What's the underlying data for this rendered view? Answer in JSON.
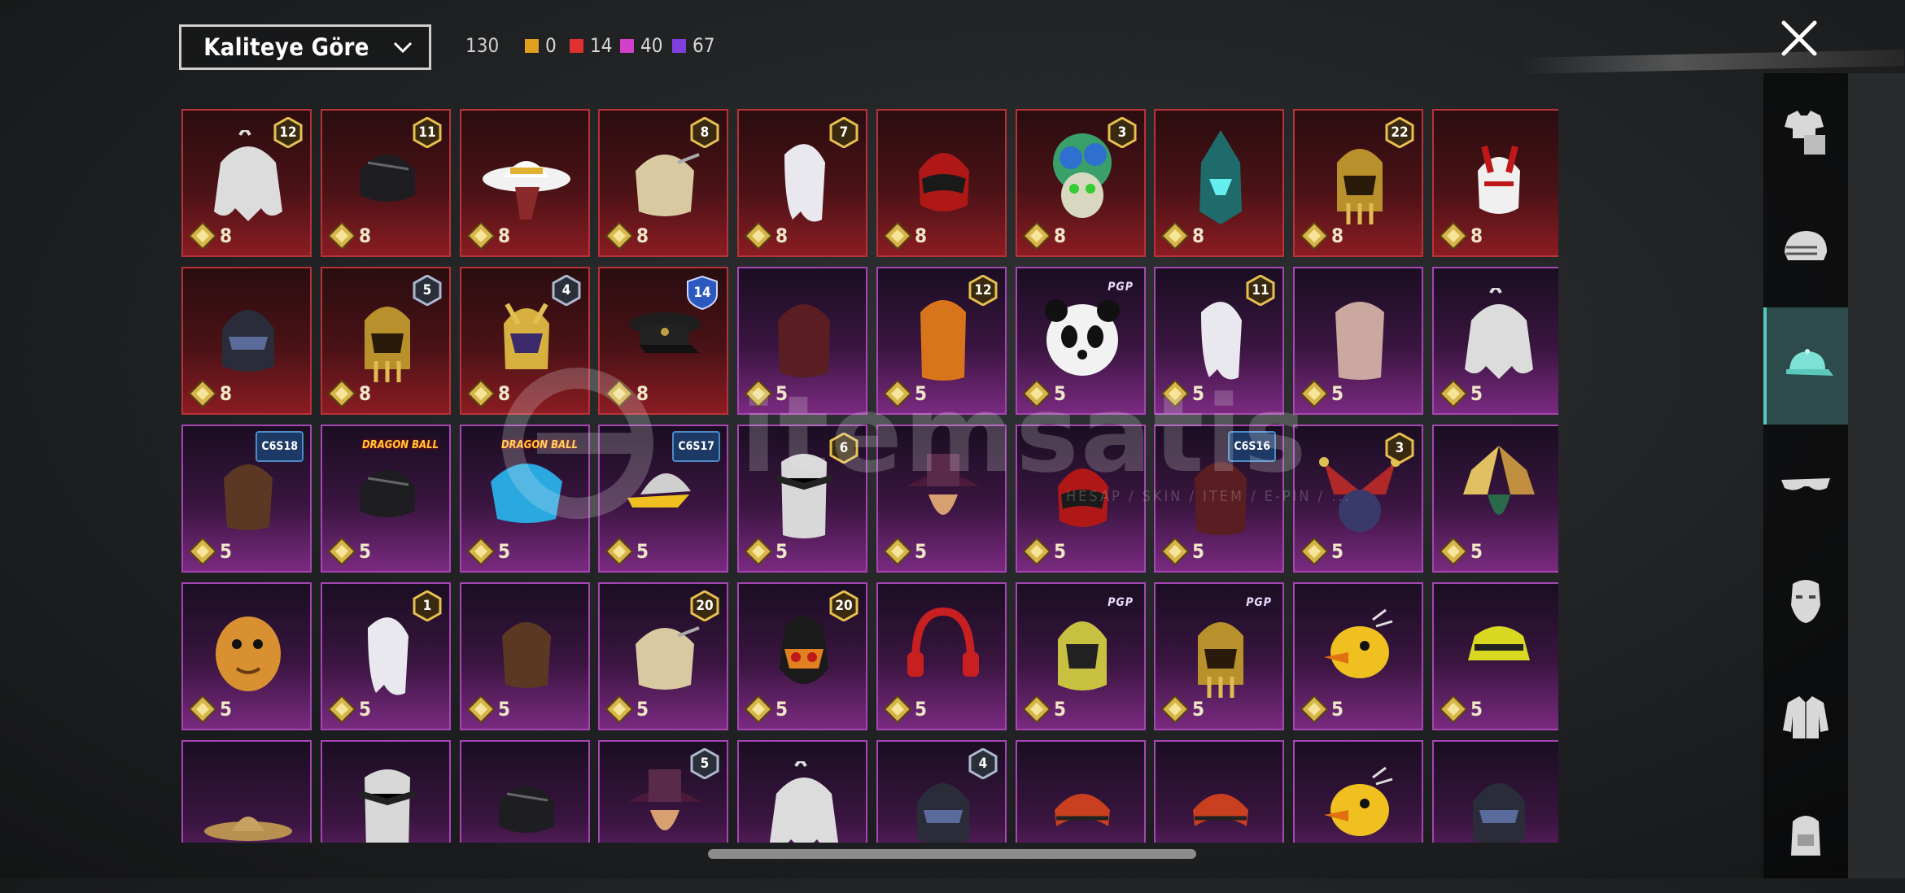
{
  "sort": {
    "label": "Kaliteye Göre"
  },
  "total_count": "130",
  "quality_counts": [
    {
      "value": "0",
      "color": "#e0a020"
    },
    {
      "value": "14",
      "color": "#e03030"
    },
    {
      "value": "40",
      "color": "#d040c8"
    },
    {
      "value": "67",
      "color": "#8040e0"
    }
  ],
  "watermark": {
    "text": "itemsatis",
    "subtitle": "HESAP / SKIN / ITEM / E-PIN / ..."
  },
  "sidebar_tabs": [
    "outfit-icon",
    "helmet-icon",
    "cap-icon",
    "glasses-icon",
    "mask-icon",
    "jacket-icon",
    "backpack-icon"
  ],
  "active_tab": 2,
  "items": [
    {
      "q": "8",
      "c": "red",
      "b": "12",
      "t": "num-gold",
      "art": "hair-white"
    },
    {
      "q": "8",
      "c": "red",
      "b": "11",
      "t": "num-gold",
      "art": "hair-black"
    },
    {
      "q": "8",
      "c": "red",
      "b": "",
      "t": "",
      "art": "hat-white"
    },
    {
      "q": "8",
      "c": "red",
      "b": "8",
      "t": "num-gold",
      "art": "hair-blonde"
    },
    {
      "q": "8",
      "c": "red",
      "b": "7",
      "t": "num-gold",
      "art": "hair-silver"
    },
    {
      "q": "8",
      "c": "red",
      "b": "",
      "t": "",
      "art": "helmet-red"
    },
    {
      "q": "8",
      "c": "red",
      "b": "3",
      "t": "num-gold",
      "art": "clown-green"
    },
    {
      "q": "8",
      "c": "red",
      "b": "",
      "t": "",
      "art": "helmet-teal"
    },
    {
      "q": "8",
      "c": "red",
      "b": "22",
      "t": "num-gold",
      "art": "helmet-gold"
    },
    {
      "q": "8",
      "c": "red",
      "b": "",
      "t": "",
      "art": "mask-red"
    },
    {
      "q": "8",
      "c": "red",
      "b": "",
      "t": "",
      "art": "helmet-dark"
    },
    {
      "q": "8",
      "c": "red",
      "b": "5",
      "t": "num-dark",
      "art": "helmet-gold"
    },
    {
      "q": "8",
      "c": "red",
      "b": "4",
      "t": "num-dark",
      "art": "helmet-purple"
    },
    {
      "q": "8",
      "c": "red",
      "b": "14",
      "t": "shield",
      "art": "cap-officer"
    },
    {
      "q": "5",
      "c": "pur",
      "b": "",
      "t": "",
      "art": "hair-red"
    },
    {
      "q": "5",
      "c": "pur",
      "b": "12",
      "t": "num-gold",
      "art": "hair-orange"
    },
    {
      "q": "5",
      "c": "pur",
      "b": "PGP",
      "t": "pgp",
      "art": "panda"
    },
    {
      "q": "5",
      "c": "pur",
      "b": "11",
      "t": "num-gold",
      "art": "hair-silver"
    },
    {
      "q": "5",
      "c": "pur",
      "b": "",
      "t": "",
      "art": "hair-pink"
    },
    {
      "q": "5",
      "c": "pur",
      "b": "",
      "t": "",
      "art": "hair-white"
    },
    {
      "q": "5",
      "c": "pur",
      "b": "C6S18",
      "t": "blue",
      "art": "hair-brown"
    },
    {
      "q": "5",
      "c": "pur",
      "b": "DRAGON BALL",
      "t": "logo",
      "art": "hair-black"
    },
    {
      "q": "5",
      "c": "pur",
      "b": "DRAGON BALL",
      "t": "logo",
      "art": "hair-blue"
    },
    {
      "q": "5",
      "c": "pur",
      "b": "C6S17",
      "t": "blue",
      "art": "visor-yellow"
    },
    {
      "q": "5",
      "c": "pur",
      "b": "6",
      "t": "num-gold",
      "art": "mask-silver"
    },
    {
      "q": "5",
      "c": "pur",
      "b": "",
      "t": "",
      "art": "hat-pirate"
    },
    {
      "q": "5",
      "c": "pur",
      "b": "",
      "t": "",
      "art": "helmet-red"
    },
    {
      "q": "5",
      "c": "pur",
      "b": "C6S16",
      "t": "blue",
      "art": "hair-red"
    },
    {
      "q": "5",
      "c": "pur",
      "b": "3",
      "t": "num-gold",
      "art": "jester"
    },
    {
      "q": "5",
      "c": "pur",
      "b": "",
      "t": "",
      "art": "feather"
    },
    {
      "q": "5",
      "c": "pur",
      "b": "",
      "t": "",
      "art": "potato"
    },
    {
      "q": "5",
      "c": "pur",
      "b": "1",
      "t": "num-gold",
      "art": "hair-silver"
    },
    {
      "q": "5",
      "c": "pur",
      "b": "",
      "t": "",
      "art": "hair-brown"
    },
    {
      "q": "5",
      "c": "pur",
      "b": "20",
      "t": "num-gold",
      "art": "hair-blonde"
    },
    {
      "q": "5",
      "c": "pur",
      "b": "20",
      "t": "num-gold",
      "art": "monkey"
    },
    {
      "q": "5",
      "c": "pur",
      "b": "",
      "t": "",
      "art": "headset-red"
    },
    {
      "q": "5",
      "c": "pur",
      "b": "PGP",
      "t": "pgp",
      "art": "helmet-yellow"
    },
    {
      "q": "5",
      "c": "pur",
      "b": "PGP",
      "t": "pgp",
      "art": "helmet-gold"
    },
    {
      "q": "5",
      "c": "pur",
      "b": "",
      "t": "",
      "art": "duck"
    },
    {
      "q": "5",
      "c": "pur",
      "b": "",
      "t": "",
      "art": "bucket-hat"
    },
    {
      "q": "",
      "c": "pur",
      "b": "",
      "t": "",
      "art": "hat-straw"
    },
    {
      "q": "",
      "c": "pur",
      "b": "",
      "t": "",
      "art": "mask-silver"
    },
    {
      "q": "",
      "c": "pur",
      "b": "",
      "t": "",
      "art": "hair-black"
    },
    {
      "q": "",
      "c": "pur",
      "b": "5",
      "t": "num-dark",
      "art": "hat-pirate"
    },
    {
      "q": "",
      "c": "pur",
      "b": "",
      "t": "",
      "art": "hair-white"
    },
    {
      "q": "",
      "c": "pur",
      "b": "4",
      "t": "num-dark",
      "art": "helmet-dark"
    },
    {
      "q": "",
      "c": "pur",
      "b": "",
      "t": "",
      "art": "headband-red"
    },
    {
      "q": "",
      "c": "pur",
      "b": "",
      "t": "",
      "art": "headband-red"
    },
    {
      "q": "",
      "c": "pur",
      "b": "",
      "t": "",
      "art": "duck"
    },
    {
      "q": "",
      "c": "pur",
      "b": "",
      "t": "",
      "art": "helmet-dark"
    }
  ]
}
